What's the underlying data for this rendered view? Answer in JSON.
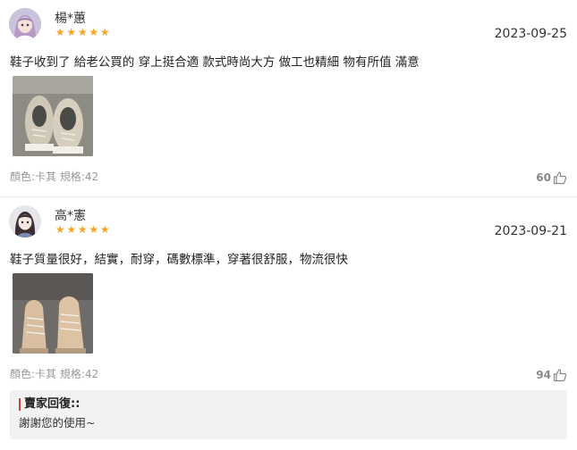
{
  "reviews": [
    {
      "username": "楊*蕙",
      "rating": 5,
      "date": "2023-09-25",
      "content": "鞋子收到了 給老公買的 穿上挺合適 款式時尚大方 做工也精細 物有所值 滿意",
      "spec": "顏色:卡其 規格:42",
      "likes": "60",
      "avatar_icon": "anime-avatar-icon",
      "photo_icon": "shoe-photo-icon"
    },
    {
      "username": "高*憲",
      "rating": 5,
      "date": "2023-09-21",
      "content": "鞋子質量很好，結實，耐穿，碼數標準，穿著很舒服，物流很快",
      "spec": "顏色:卡其 規格:42",
      "likes": "94",
      "avatar_icon": "anime-avatar-icon",
      "photo_icon": "shoe-photo-icon",
      "reply": {
        "title": "賣家回復::",
        "text": "謝謝您的使用~"
      }
    }
  ],
  "colors": {
    "star": "#f5a623",
    "accent_bar": "#e03c3c",
    "spec_text": "#999999",
    "reply_bg": "#f2f2f2"
  }
}
